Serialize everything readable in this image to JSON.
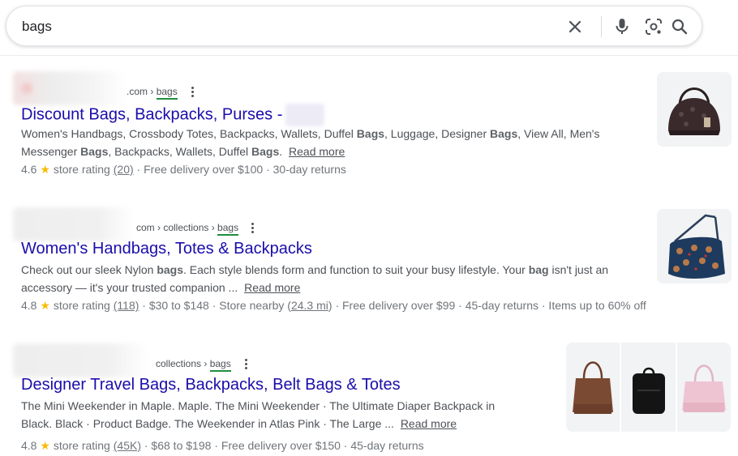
{
  "search": {
    "query": "bags",
    "clear_icon": "close-icon",
    "voice_icon": "mic-icon",
    "lens_icon": "lens-icon",
    "search_icon": "search-icon"
  },
  "results": [
    {
      "domain_suffix": ".com ›",
      "path_last": "bags",
      "title": "Discount Bags, Backpacks, Purses -",
      "snippet_line1": [
        "Women's Handbags, Crossbody Totes, Backpacks, Wallets, Duffel ",
        "Bags",
        ", Luggage, Designer ",
        "Bags",
        ", View All, Men's"
      ],
      "snippet_line2": [
        "Messenger ",
        "Bags",
        ", Backpacks, Wallets, Duffel ",
        "Bags",
        ". "
      ],
      "read_more": "Read more",
      "rating": "4.6",
      "rating_label": "store rating",
      "reviews": "(20)",
      "extra": "· Free delivery over $100 · 30-day returns"
    },
    {
      "domain_suffix": "com › collections ›",
      "path_last": "bags",
      "title": "Women's Handbags, Totes & Backpacks",
      "snippet_line1": [
        "Check out our sleek Nylon ",
        "bags",
        ". Each style blends form and function to suit your busy lifestyle. Your ",
        "bag",
        " isn't just an"
      ],
      "snippet_line2": [
        "accessory — it's your trusted companion ... "
      ],
      "read_more": "Read more",
      "rating": "4.8",
      "rating_label": "store rating",
      "reviews": "(118)",
      "extra_pre": "· $30 to $148 · Store nearby (",
      "nearby": "24.3 mi",
      "extra_post": ") · Free delivery over $99 · 45-day returns · Items up to 60% off"
    },
    {
      "domain_suffix": "collections ›",
      "path_last": "bags",
      "title": "Designer Travel Bags, Backpacks, Belt Bags & Totes",
      "snippet_line1": "The Mini Weekender in Maple. Maple. The Mini Weekender · The Ultimate Diaper Backpack in",
      "snippet_line2": "Black. Black · Product Badge. The Weekender in Atlas Pink · The Large ... ",
      "read_more": "Read more",
      "rating": "4.8",
      "rating_label": "store rating",
      "reviews": "(45K)",
      "extra": "· $68 to $198 · Free delivery over $150 · 45-day returns"
    }
  ],
  "colors": {
    "link_title": "#1a0dab",
    "path_underline": "#1e8e3e",
    "star": "#fbbc04"
  }
}
